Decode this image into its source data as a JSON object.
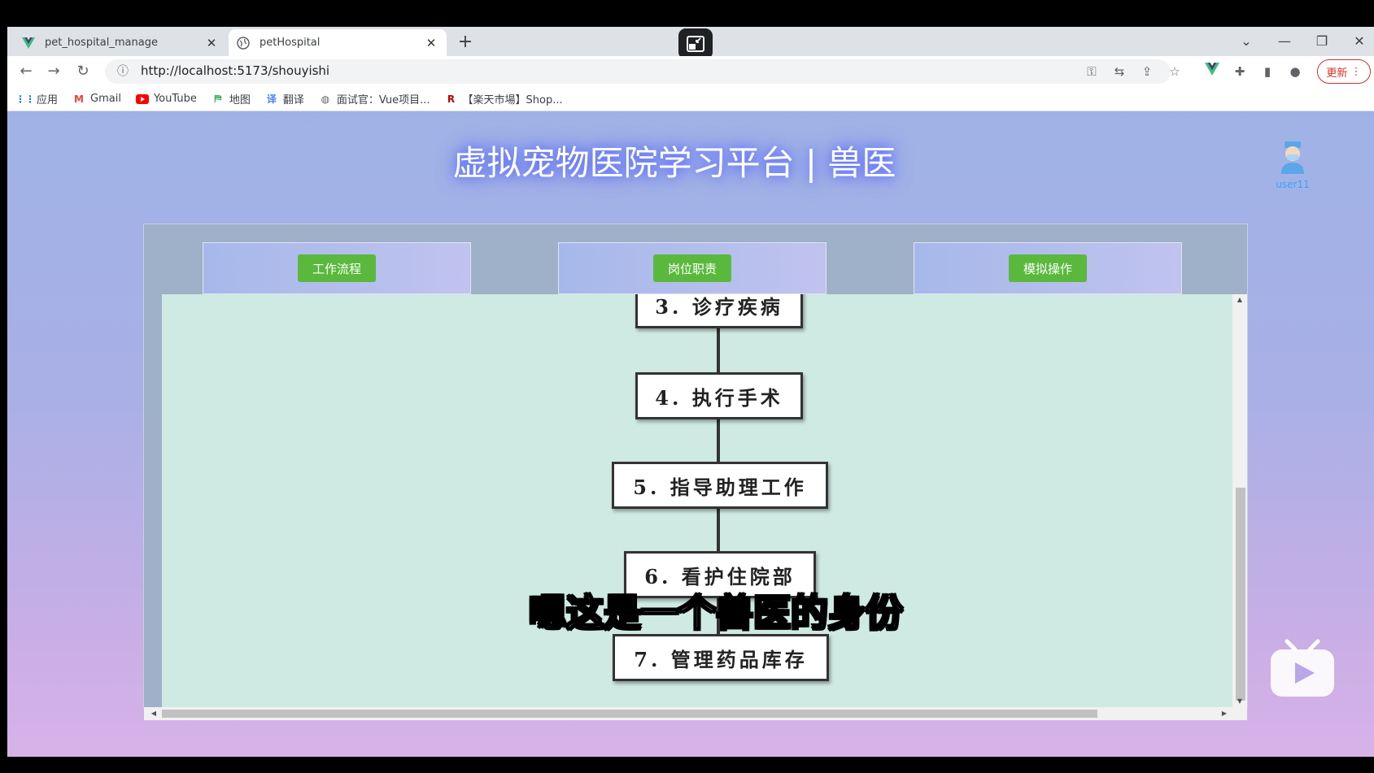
{
  "browser": {
    "tabs": [
      {
        "title": "pet_hospital_manage",
        "favicon": "vue-icon",
        "active": false
      },
      {
        "title": "petHospital",
        "favicon": "globe-icon",
        "active": true
      }
    ],
    "url": "http://localhost:5173/shouyishi",
    "update_label": "更新",
    "bookmarks": [
      {
        "label": "应用",
        "icon": "apps-grid-icon"
      },
      {
        "label": "Gmail",
        "icon": "gmail-icon"
      },
      {
        "label": "YouTube",
        "icon": "youtube-icon"
      },
      {
        "label": "地图",
        "icon": "maps-icon"
      },
      {
        "label": "翻译",
        "icon": "translate-icon"
      },
      {
        "label": "面试官：Vue项目...",
        "icon": "globe-icon"
      },
      {
        "label": "【楽天市場】Shop...",
        "icon": "rakuten-icon"
      }
    ]
  },
  "page": {
    "title": "虚拟宠物医院学习平台 | 兽医",
    "user": {
      "name": "user11"
    },
    "nav": [
      {
        "label": "工作流程"
      },
      {
        "label": "岗位职责"
      },
      {
        "label": "模拟操作"
      }
    ],
    "flow_steps": [
      "3. 诊疗疾病",
      "4. 执行手术",
      "5. 指导助理工作",
      "6. 看护住院部",
      "7. 管理药品库存"
    ]
  },
  "overlay": {
    "subtitle": "嗯这是一个兽医的身份"
  },
  "colors": {
    "nav_button": "#5ab93d",
    "content_bg": "#cfe9e3",
    "title_glow": "#5c6cff",
    "update_button": "#d93025"
  }
}
